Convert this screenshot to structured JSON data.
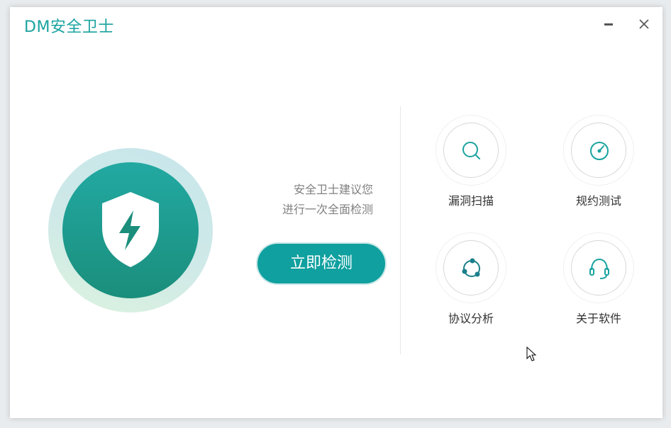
{
  "app": {
    "title": "DM安全卫士"
  },
  "colors": {
    "accent": "#1aa3a0",
    "button": "#0fa09f",
    "badge_top": "#22a9a2",
    "badge_bottom": "#1b8e7c"
  },
  "window_controls": {
    "minimize_icon": "minimize-icon",
    "close_icon": "close-icon"
  },
  "main": {
    "advice_line1": "安全卫士建议您",
    "advice_line2": "进行一次全面检测",
    "scan_button": "立即检测",
    "badge_icon": "shield-bolt-icon"
  },
  "tools": [
    {
      "label": "漏洞扫描",
      "icon": "search-icon"
    },
    {
      "label": "规约测试",
      "icon": "gauge-icon"
    },
    {
      "label": "协议分析",
      "icon": "network-cycle-icon"
    },
    {
      "label": "关于软件",
      "icon": "headset-icon"
    }
  ]
}
